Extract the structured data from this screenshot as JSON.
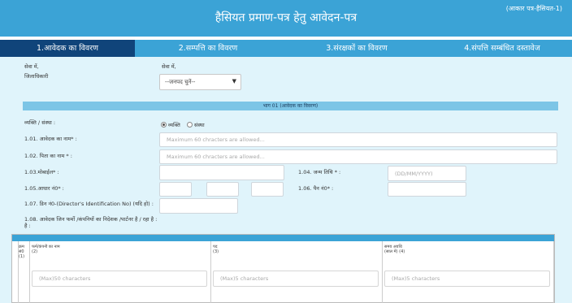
{
  "header": {
    "title": "हैसियत प्रमाण-पत्र हेतु आवेदन-पत्र",
    "form_code": "(आकार पत्र-हैसियत-1)"
  },
  "tabs": [
    {
      "label": "1.आवेदक का विवरण",
      "active": true
    },
    {
      "label": "2.सम्पत्ति का विवरण",
      "active": false
    },
    {
      "label": "3.संरक्षकों का विवरण",
      "active": false
    },
    {
      "label": "4.संपत्ति सम्बंधित दस्तावेज",
      "active": false
    }
  ],
  "addressee": {
    "to_label": "सेवा में,",
    "to_value": "जिलाधिकारी",
    "to_label_2": "सेवा में,",
    "district_select": {
      "selected": "--जनपद चुनें--"
    }
  },
  "section": {
    "title": "भाग 01 (आवेदक का विवरण)"
  },
  "applicant_type": {
    "label": "व्यक्ति / संस्था :",
    "options": [
      {
        "label": "व्यक्ति",
        "checked": true
      },
      {
        "label": "संस्था",
        "checked": false
      }
    ]
  },
  "fields": {
    "applicant_name": {
      "label": "1.01. आवेदक का नाम* :",
      "placeholder": "Maximum 60 chracters are allowed..."
    },
    "father_name": {
      "label": "1.02. पिता का नाम * :",
      "placeholder": "Maximum 60 chracters are allowed..."
    },
    "mobile": {
      "label": "1.03.मोबाईल* :",
      "value": ""
    },
    "dob": {
      "label": "1.04. जन्म तिथि * :",
      "placeholder": "(DD/MM/YYYY)"
    },
    "aadhaar": {
      "label": "1.05.आधार नं0* :"
    },
    "pan": {
      "label": "1.06. पैन नं0* :"
    },
    "din": {
      "label": "1.07. डिन नं0-(Director's Identification No) (यदि हो) :"
    },
    "companies": {
      "label": "1.08. आवेदक जिन फर्मो /कंपनियों का निदेशक /पार्टनर है / रहा है :"
    }
  },
  "company_table": {
    "columns": [
      {
        "line1": "क्रम",
        "line2": "सं0",
        "line3": "(1)"
      },
      {
        "line1": "फर्म/कंपनी का नाम",
        "line2": "(2)"
      },
      {
        "line1": "पद",
        "line2": "(3)"
      },
      {
        "line1": "समय अवधि",
        "line2": "(साल में) (4)"
      }
    ],
    "row_placeholders": [
      "(Max)50 characters",
      "(Max)5 characters",
      "(Max)5 characters"
    ]
  }
}
